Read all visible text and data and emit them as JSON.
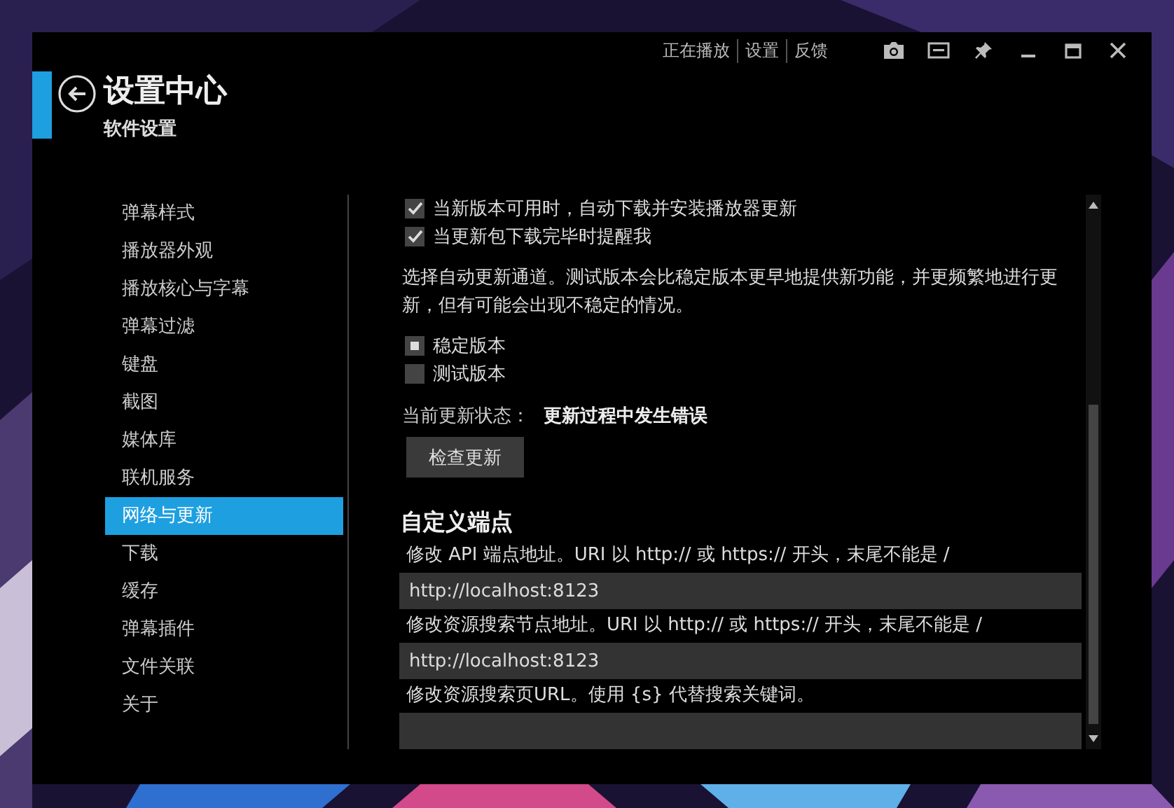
{
  "top_links": [
    {
      "label": "正在播放"
    },
    {
      "label": "设置"
    },
    {
      "label": "反馈"
    }
  ],
  "header": {
    "title": "设置中心",
    "subtitle": "软件设置"
  },
  "sidebar": {
    "items": [
      {
        "label": "弹幕样式",
        "selected": false
      },
      {
        "label": "播放器外观",
        "selected": false
      },
      {
        "label": "播放核心与字幕",
        "selected": false
      },
      {
        "label": "弹幕过滤",
        "selected": false
      },
      {
        "label": "键盘",
        "selected": false
      },
      {
        "label": "截图",
        "selected": false
      },
      {
        "label": "媒体库",
        "selected": false
      },
      {
        "label": "联机服务",
        "selected": false
      },
      {
        "label": "网络与更新",
        "selected": true
      },
      {
        "label": "下载",
        "selected": false
      },
      {
        "label": "缓存",
        "selected": false
      },
      {
        "label": "弹幕插件",
        "selected": false
      },
      {
        "label": "文件关联",
        "selected": false
      },
      {
        "label": "关于",
        "selected": false
      }
    ]
  },
  "update": {
    "options": [
      {
        "label": "当新版本可用时，自动下载并安装播放器更新",
        "checked": true
      },
      {
        "label": "当更新包下载完毕时提醒我",
        "checked": true
      }
    ],
    "channel_description": "选择自动更新通道。测试版本会比稳定版本更早地提供新功能，并更频繁地进行更新，但有可能会出现不稳定的情况。",
    "channels": [
      {
        "label": "稳定版本",
        "selected": true
      },
      {
        "label": "测试版本",
        "selected": false
      }
    ],
    "status_label": "当前更新状态：",
    "status_value": "更新过程中发生错误",
    "check_button": "检查更新"
  },
  "endpoints": {
    "heading": "自定义端点",
    "fields": [
      {
        "label": "修改 API 端点地址。URI 以 http:// 或 https:// 开头，末尾不能是 /",
        "value": "http://localhost:8123"
      },
      {
        "label": "修改资源搜索节点地址。URI 以 http:// 或 https:// 开头，末尾不能是 /",
        "value": "http://localhost:8123"
      },
      {
        "label": "修改资源搜索页URL。使用 {s} 代替搜索关键词。"
      }
    ]
  }
}
